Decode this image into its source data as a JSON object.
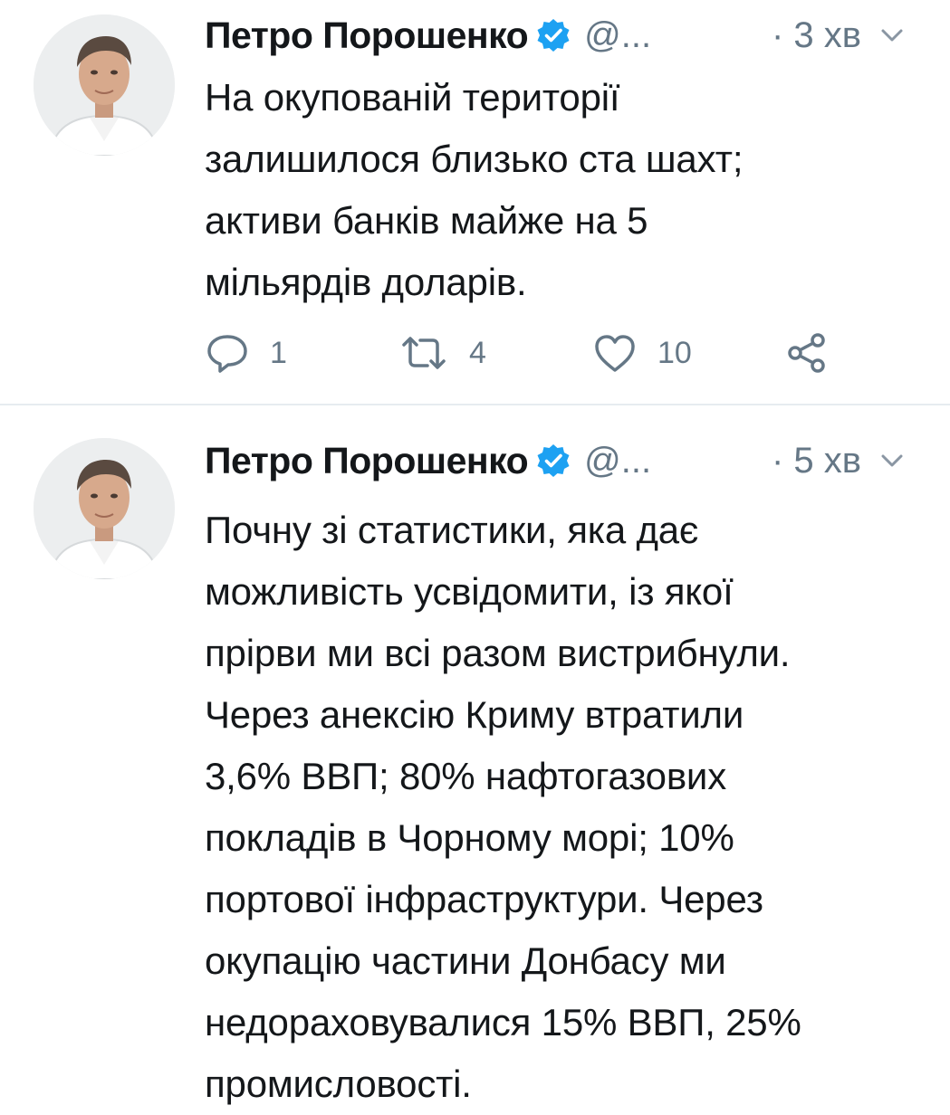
{
  "tweets": [
    {
      "author_name": "Петро Порошенко",
      "handle": "@...",
      "time": "· 3 хв",
      "text": "На окупованій території\nзалишилося близько ста шахт;\nактиви банків майже на 5\nмільярдів доларів.",
      "replies": "1",
      "retweets": "4",
      "likes": "10"
    },
    {
      "author_name": "Петро Порошенко",
      "handle": "@...",
      "time": "· 5 хв",
      "text": "Почну зі статистики, яка дає\nможливість усвідомити, із якої\nпрірви ми всі разом вистрибнули.\nЧерез анексію Криму втратили\n3,6% ВВП; 80% нафтогазових\nпокладів в Чорному морі; 10%\nпортової інфраструктури. Через\nокупацію частини Донбасу ми\nнедораховувалися 15% ВВП,  25%\nпромисловості."
    }
  ],
  "icons": {
    "verified": "verified-badge-icon",
    "caret": "chevron-down-icon",
    "reply": "reply-icon",
    "retweet": "retweet-icon",
    "like": "heart-icon",
    "share": "share-icon"
  },
  "colors": {
    "text": "#14171a",
    "secondary": "#657786",
    "verified": "#1da1f2",
    "divider": "#e6ecf0"
  }
}
